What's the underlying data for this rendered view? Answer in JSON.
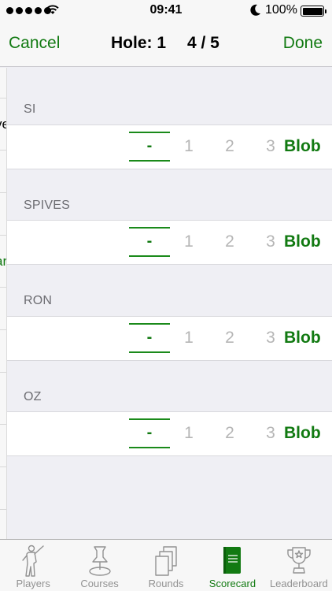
{
  "status": {
    "time": "09:41",
    "battery": "100%",
    "signal_bars": 5
  },
  "nav": {
    "cancel": "Cancel",
    "title": "Hole: 1",
    "counter": "4 / 5",
    "done": "Done"
  },
  "background_peek": {
    "text_1": "ve",
    "text_2": "ar"
  },
  "players": [
    {
      "name": "SI",
      "score": "-",
      "options": [
        "1",
        "2",
        "3"
      ],
      "blob": "Blob"
    },
    {
      "name": "SPIVES",
      "score": "-",
      "options": [
        "1",
        "2",
        "3"
      ],
      "blob": "Blob"
    },
    {
      "name": "RON",
      "score": "-",
      "options": [
        "1",
        "2",
        "3"
      ],
      "blob": "Blob"
    },
    {
      "name": "OZ",
      "score": "-",
      "options": [
        "1",
        "2",
        "3"
      ],
      "blob": "Blob"
    }
  ],
  "tabs": [
    {
      "label": "Players",
      "icon": "golfer-icon",
      "active": false
    },
    {
      "label": "Courses",
      "icon": "pin-icon",
      "active": false
    },
    {
      "label": "Rounds",
      "icon": "cards-icon",
      "active": false
    },
    {
      "label": "Scorecard",
      "icon": "scorecard-icon",
      "active": true
    },
    {
      "label": "Leaderboard",
      "icon": "trophy-icon",
      "active": false
    }
  ],
  "colors": {
    "accent": "#127a12",
    "inactive": "#929292",
    "muted_option": "#b5b5b5"
  }
}
